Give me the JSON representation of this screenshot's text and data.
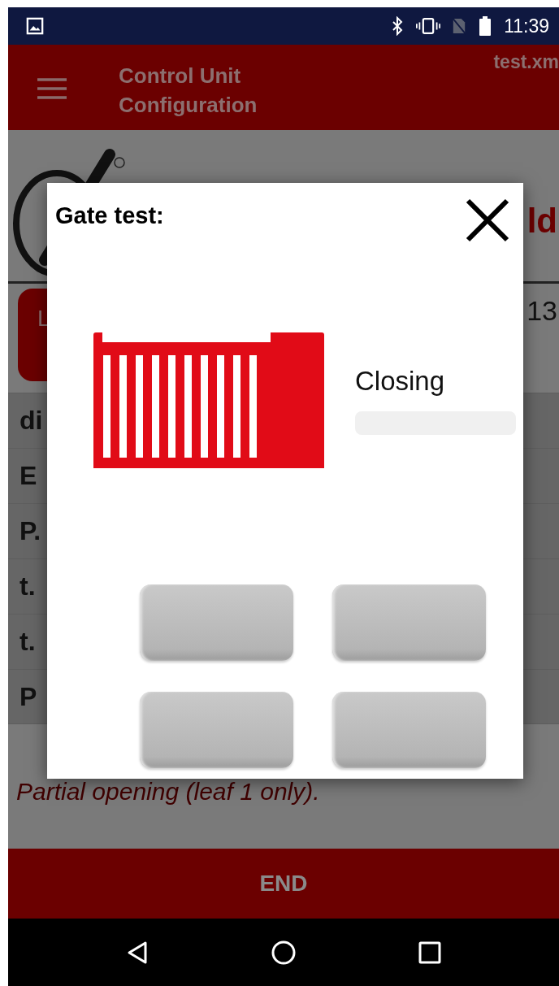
{
  "status_bar": {
    "time": "11:39"
  },
  "app_bar": {
    "title": "Control Unit Configuration",
    "file": "test.xm"
  },
  "background": {
    "heading_fragment": "ld",
    "button_fragment": "L",
    "value_fragment": "13",
    "rows": [
      "di",
      "E",
      "P.",
      "t.",
      "t.",
      "P"
    ],
    "note": "Partial opening (leaf 1 only)."
  },
  "dialog": {
    "title": "Gate test:",
    "status": "Closing",
    "progress": {
      "level": 0
    },
    "buttons": [
      {
        "kind": "blank"
      },
      {
        "kind": "blank"
      },
      {
        "kind": "blank"
      },
      {
        "kind": "blank"
      }
    ]
  },
  "footer_button": "END"
}
